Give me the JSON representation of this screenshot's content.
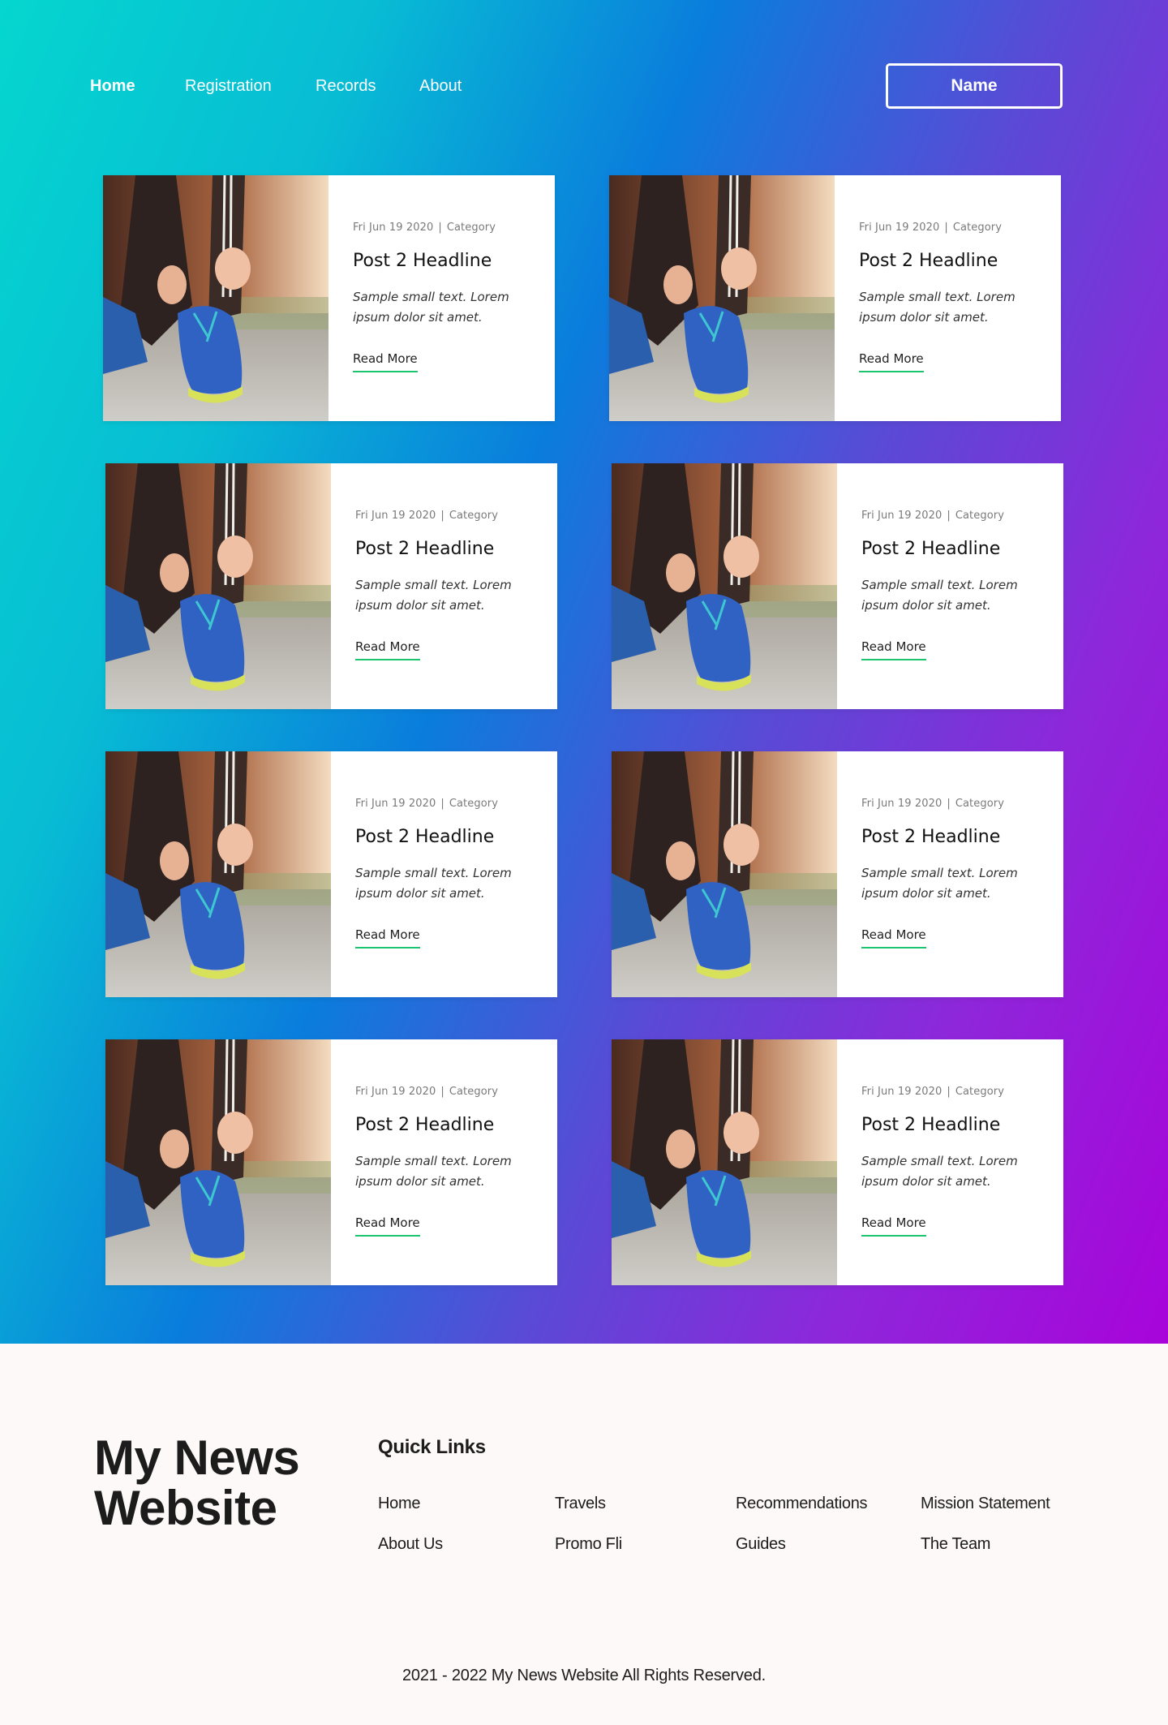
{
  "nav": {
    "links": [
      "Home",
      "Registration",
      "Records",
      "About"
    ],
    "active": "Home",
    "name_button": "Name"
  },
  "posts": [
    {
      "date": "Fri Jun 19 2020",
      "category": "Category",
      "headline": "Post 2 Headline",
      "excerpt": "Sample small text. Lorem ipsum dolor sit amet.",
      "cta": "Read More"
    },
    {
      "date": "Fri Jun 19 2020",
      "category": "Category",
      "headline": "Post 2 Headline",
      "excerpt": "Sample small text. Lorem ipsum dolor sit amet.",
      "cta": "Read More"
    },
    {
      "date": "Fri Jun 19 2020",
      "category": "Category",
      "headline": "Post 2 Headline",
      "excerpt": "Sample small text. Lorem ipsum dolor sit amet.",
      "cta": "Read More"
    },
    {
      "date": "Fri Jun 19 2020",
      "category": "Category",
      "headline": "Post 2 Headline",
      "excerpt": "Sample small text. Lorem ipsum dolor sit amet.",
      "cta": "Read More"
    },
    {
      "date": "Fri Jun 19 2020",
      "category": "Category",
      "headline": "Post 2 Headline",
      "excerpt": "Sample small text. Lorem ipsum dolor sit amet.",
      "cta": "Read More"
    },
    {
      "date": "Fri Jun 19 2020",
      "category": "Category",
      "headline": "Post 2 Headline",
      "excerpt": "Sample small text. Lorem ipsum dolor sit amet.",
      "cta": "Read More"
    },
    {
      "date": "Fri Jun 19 2020",
      "category": "Category",
      "headline": "Post 2 Headline",
      "excerpt": "Sample small text. Lorem ipsum dolor sit amet.",
      "cta": "Read More"
    },
    {
      "date": "Fri Jun 19 2020",
      "category": "Category",
      "headline": "Post 2 Headline",
      "excerpt": "Sample small text. Lorem ipsum dolor sit amet.",
      "cta": "Read More"
    }
  ],
  "footer": {
    "brand": "My News Website",
    "quick_links_title": "Quick Links",
    "links": [
      "Home",
      "Travels",
      "Recommendations",
      "Mission Statement",
      "About Us",
      "Promo Fli",
      "Guides",
      "The Team"
    ],
    "copyright": "2021 - 2022 My News Website All Rights Reserved."
  },
  "colors": {
    "gradient_start": "#05d6cf",
    "gradient_mid": "#0a7ddc",
    "gradient_end": "#a804da",
    "accent_underline": "#1cc46d"
  }
}
